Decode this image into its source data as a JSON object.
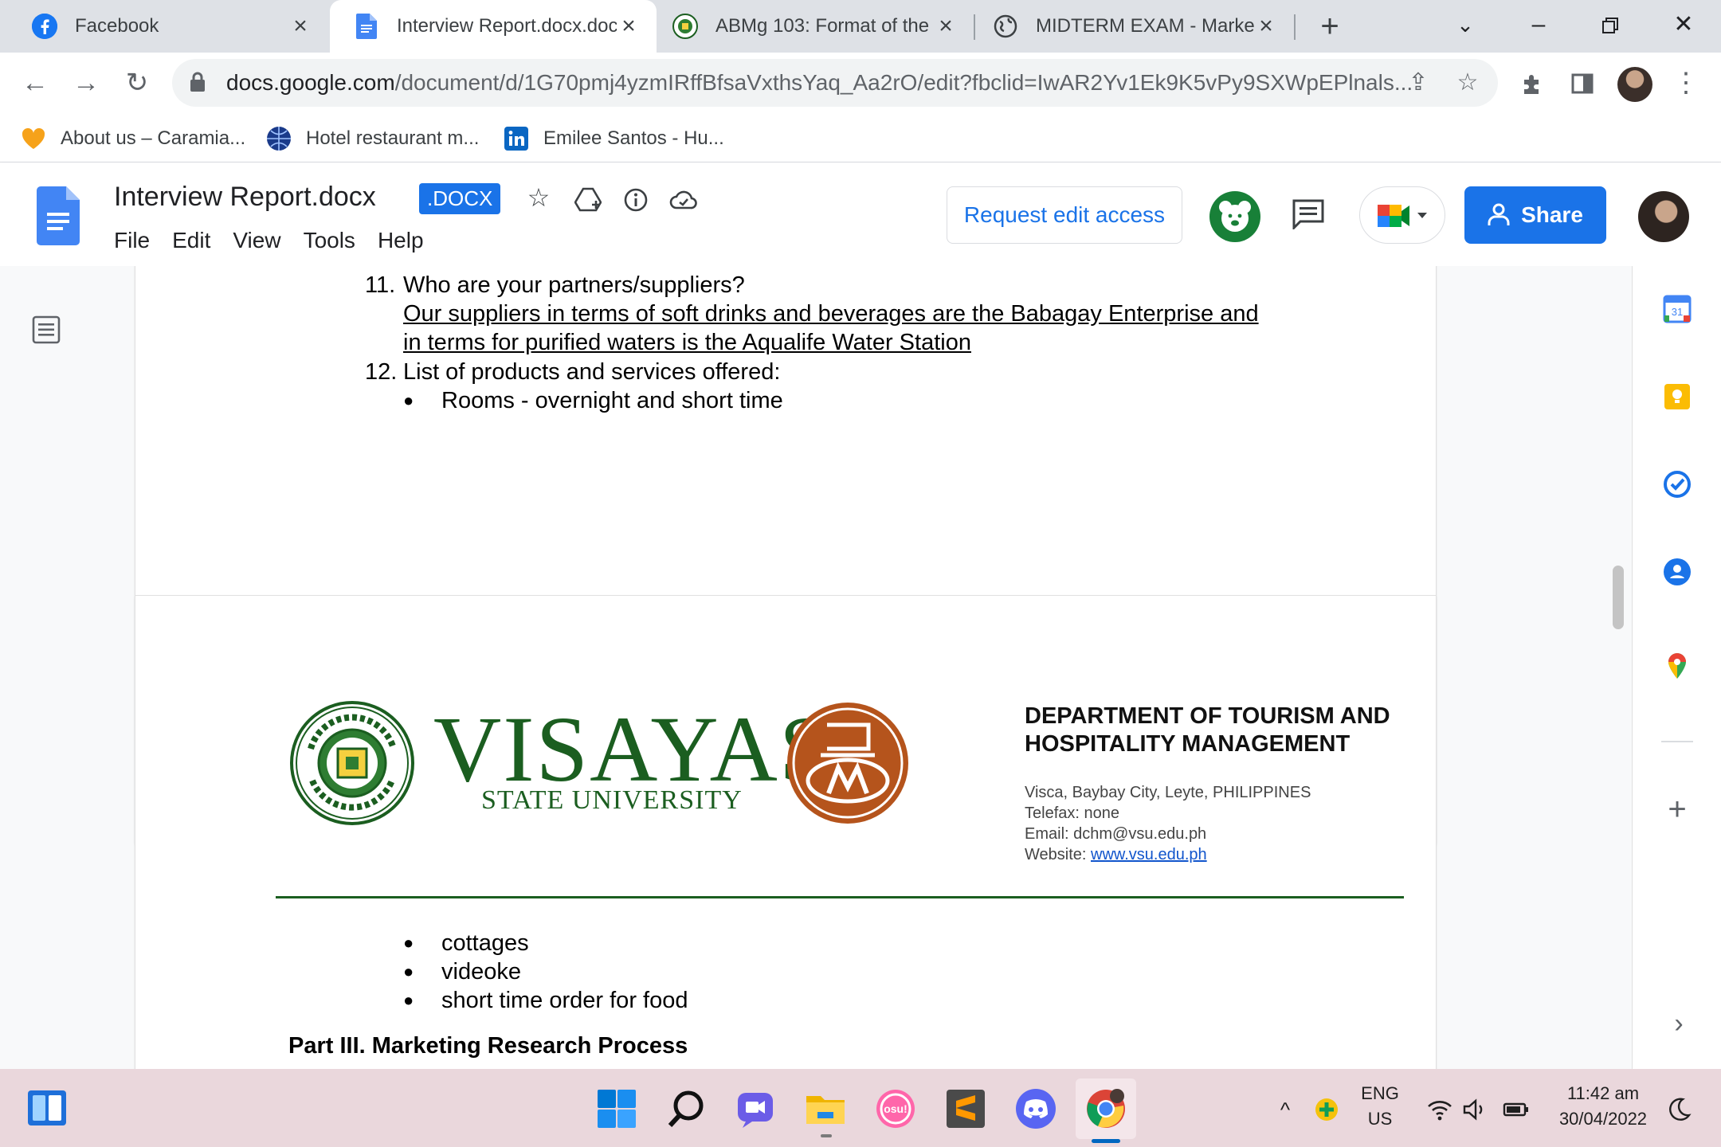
{
  "browser": {
    "tabs": [
      {
        "title": "Facebook",
        "icon": "facebook-icon",
        "active": false
      },
      {
        "title": "Interview Report.docx.doc",
        "icon": "docs-icon",
        "active": true
      },
      {
        "title": "ABMg 103: Format of the",
        "icon": "vsu-seal-icon",
        "active": false
      },
      {
        "title": "MIDTERM EXAM - Market",
        "icon": "globe-icon",
        "active": false
      }
    ],
    "url_main": "docs.google.com",
    "url_rest": "/document/d/1G70pmj4yzmIRffBfsaVxthsYaq_Aa2rO/edit?fbclid=IwAR2Yv1Ek9K5vPy9SXWpEPlnals...",
    "bookmarks": [
      {
        "label": "About us – Caramia...",
        "icon": "heart-icon"
      },
      {
        "label": "Hotel restaurant m...",
        "icon": "globe-blue-icon"
      },
      {
        "label": "Emilee Santos - Hu...",
        "icon": "linkedin-icon"
      }
    ]
  },
  "docs": {
    "title": "Interview Report.docx",
    "badge": ".DOCX",
    "menu": [
      "File",
      "Edit",
      "View",
      "Tools",
      "Help"
    ],
    "request_edit": "Request edit access",
    "share": "Share",
    "accent": "#1a73e8"
  },
  "document": {
    "q11_num": "11.",
    "q11": "Who are your partners/suppliers?",
    "a11_line1": "Our suppliers in terms of soft drinks and beverages are the Babagay Enterprise and",
    "a11_line2": "in terms for purified waters is the Aqualife Water Station",
    "q12_num": "12.",
    "q12": "List of products and services offered:",
    "bullet_page1": [
      "Rooms - overnight and short time"
    ],
    "letterhead": {
      "university_main": "VISAYAS",
      "university_sub": "STATE UNIVERSITY",
      "dept_title": "DEPARTMENT OF TOURISM AND HOSPITALITY MANAGEMENT",
      "address": "Visca, Baybay City, Leyte, PHILIPPINES",
      "telefax": "Telefax: none",
      "email": "Email: dchm@vsu.edu.ph",
      "website_label": "Website: ",
      "website_link": "www.vsu.edu.ph",
      "brand_green": "#1b5e20",
      "cm_brown": "#b5541c"
    },
    "bullet_page2": [
      "cottages",
      "videoke",
      "short time order for food"
    ],
    "part3_heading": "Part III.  Marketing Research Process"
  },
  "taskbar": {
    "apps": [
      "widgets-icon",
      "start-icon",
      "search-icon",
      "teams-chat-icon",
      "file-explorer-icon",
      "osu-icon",
      "sublime-icon",
      "discord-icon",
      "chrome-icon"
    ],
    "lang_top": "ENG",
    "lang_bottom": "US",
    "time": "11:42 am",
    "date": "30/04/2022"
  }
}
